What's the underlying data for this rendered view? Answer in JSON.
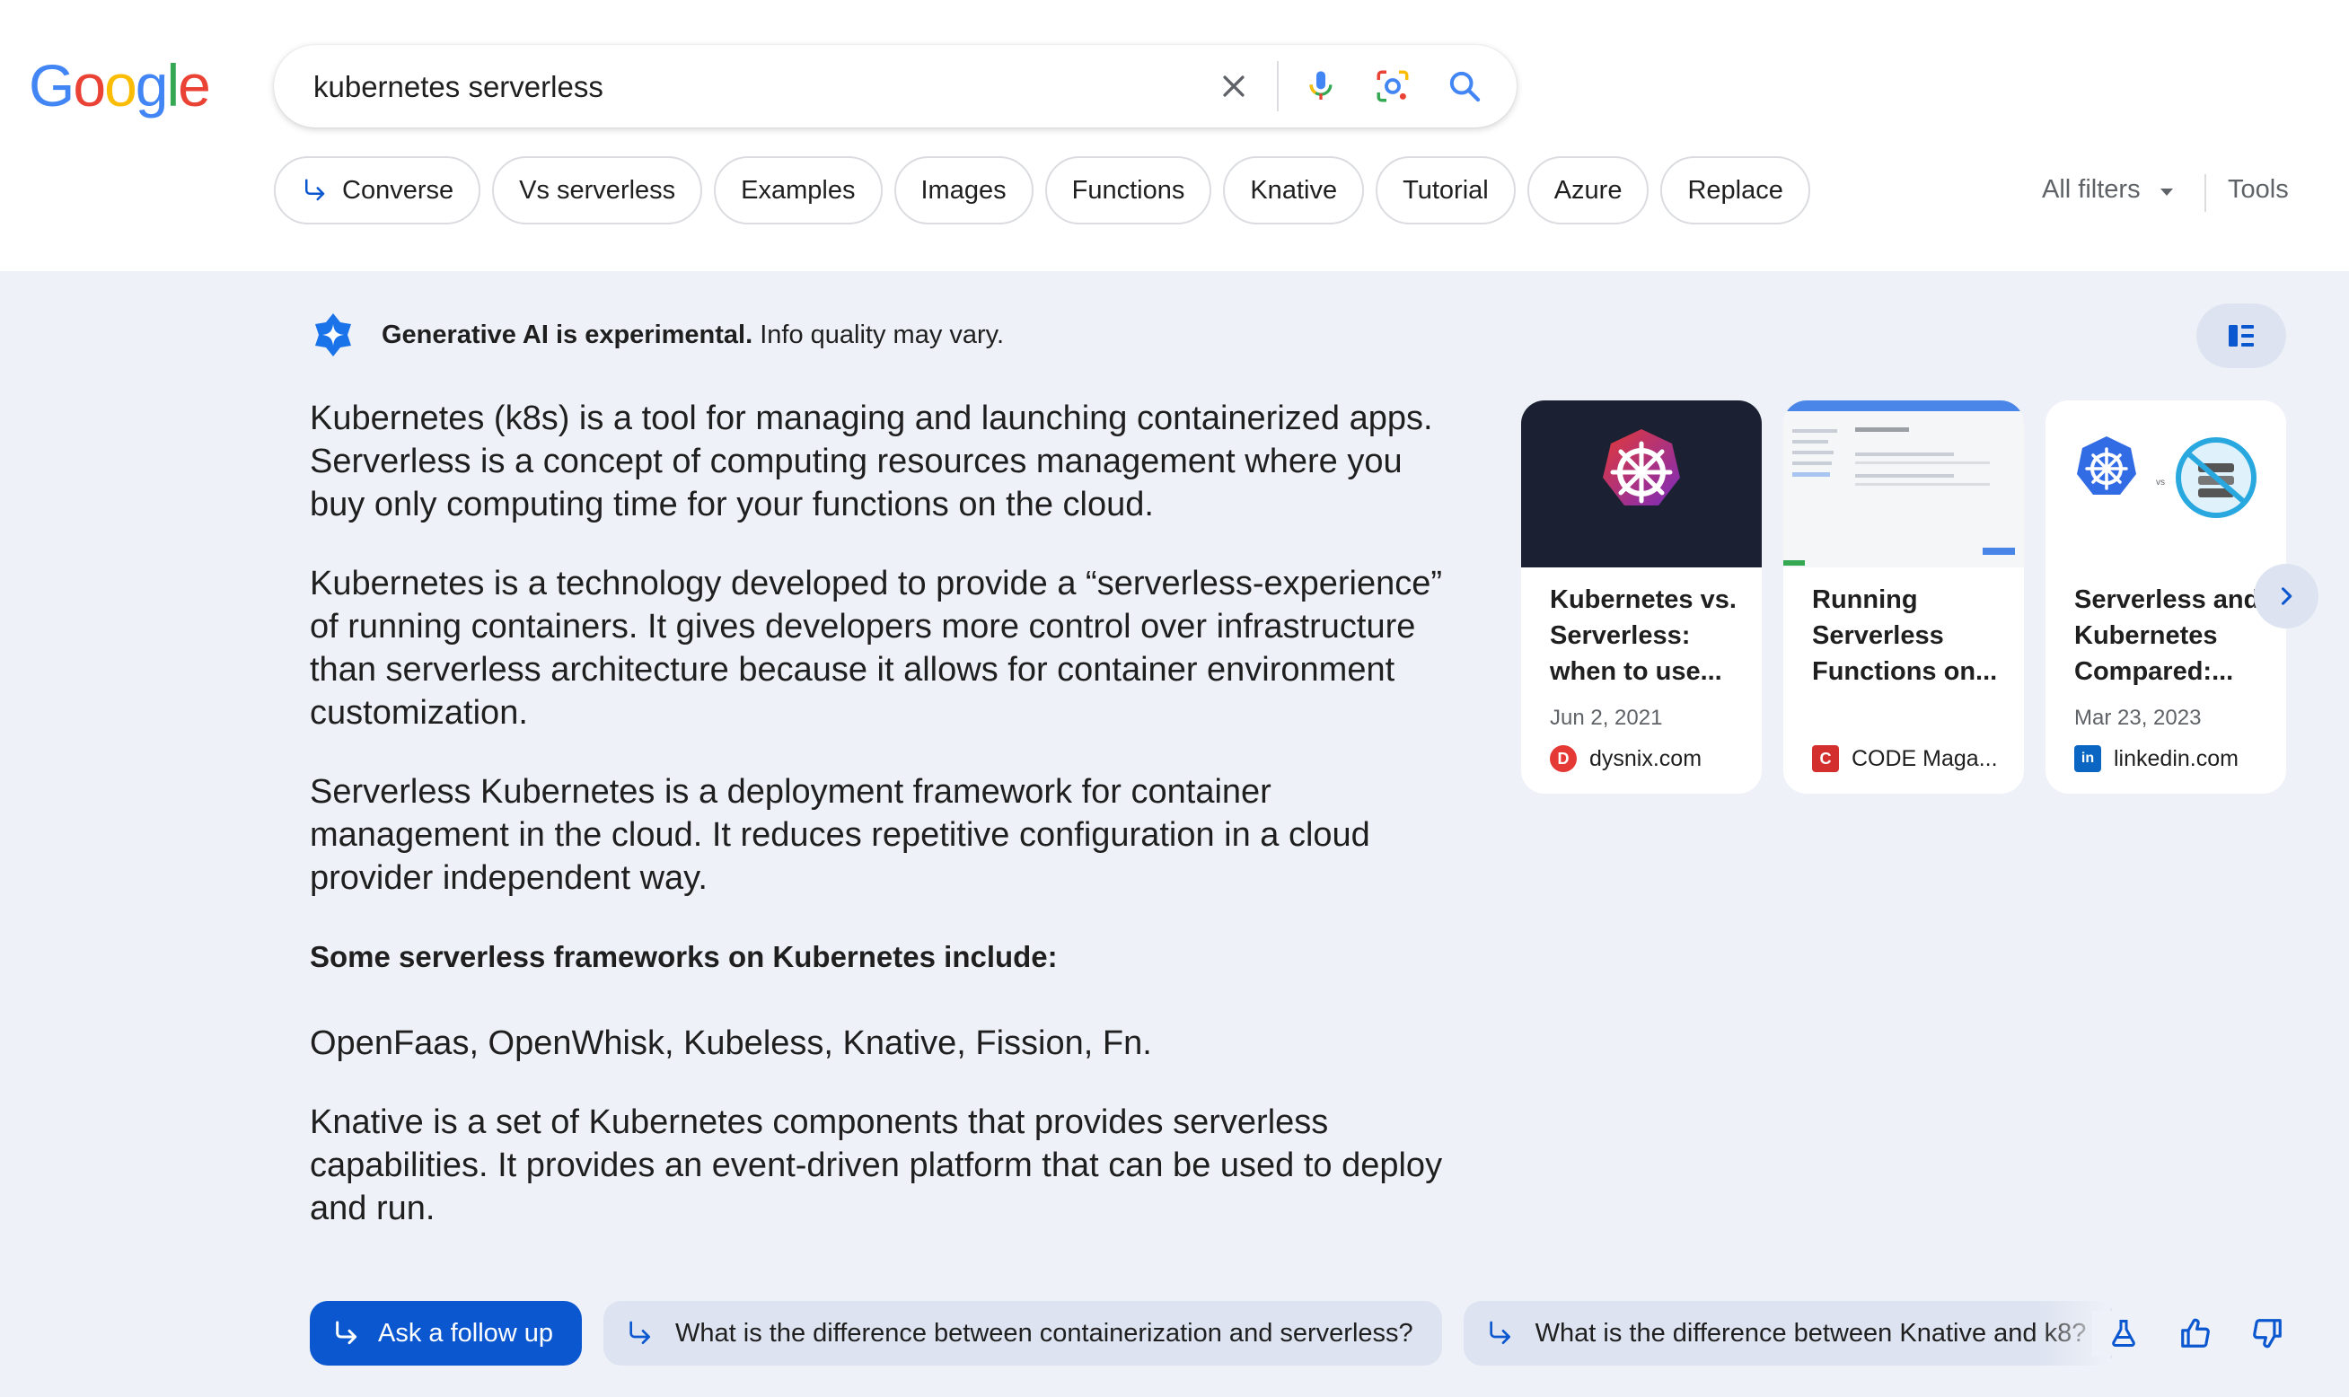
{
  "header": {
    "logo_letters": [
      "G",
      "o",
      "o",
      "g",
      "l",
      "e"
    ],
    "search": {
      "value": "kubernetes serverless"
    },
    "chips": [
      {
        "label": "Converse",
        "icon": "arrow-return-icon"
      },
      {
        "label": "Vs serverless"
      },
      {
        "label": "Examples"
      },
      {
        "label": "Images"
      },
      {
        "label": "Functions"
      },
      {
        "label": "Knative"
      },
      {
        "label": "Tutorial"
      },
      {
        "label": "Azure"
      },
      {
        "label": "Replace"
      }
    ],
    "all_filters_label": "All filters",
    "tools_label": "Tools"
  },
  "ai_overview": {
    "header_bold": "Generative AI is experimental.",
    "header_rest": " Info quality may vary.",
    "paragraphs": [
      "Kubernetes (k8s) is a tool for managing and launching containerized apps. Serverless is a concept of computing resources management where you buy only computing time for your functions on the cloud.",
      "Kubernetes is a technology developed to provide a “serverless-experience” of running containers. It gives developers more control over infrastructure than serverless architecture because it allows for container environment customization.",
      "Serverless Kubernetes is a deployment framework for container management in the cloud. It reduces repetitive configuration in a cloud provider independent way."
    ],
    "subheading": "Some serverless frameworks on Kubernetes include:",
    "frameworks": "OpenFaas, OpenWhisk, Kubeless, Knative, Fission, Fn.",
    "knative_paragraph": "Knative is a set of Kubernetes components that provides serverless capabilities. It provides an event-driven platform that can be used to deploy and run.",
    "cards": [
      {
        "title": "Kubernetes vs. Serverless: when to use...",
        "date": "Jun 2, 2021",
        "source": "dysnix.com",
        "favicon_letter": "D",
        "favicon_color": "#e53935"
      },
      {
        "title": "Running Serverless Functions on...",
        "date": "",
        "source": "CODE Maga...",
        "favicon_letter": "C",
        "favicon_color": "#d32f2f"
      },
      {
        "title": "Serverless and Kubernetes Compared:...",
        "date": "Mar 23, 2023",
        "source": "linkedin.com",
        "favicon_letter": "in",
        "favicon_color": "#0a66c2"
      }
    ],
    "follow_up_label": "Ask a follow up",
    "suggestions": [
      "What is the difference between containerization and serverless?",
      "What is the difference between Knative and k8?"
    ]
  },
  "colors": {
    "google_blue": "#4285f4",
    "google_red": "#ea4335",
    "google_yellow": "#fbbc05",
    "google_green": "#34a853",
    "accent": "#0b57d0",
    "panel_bg": "#eef1f8"
  }
}
